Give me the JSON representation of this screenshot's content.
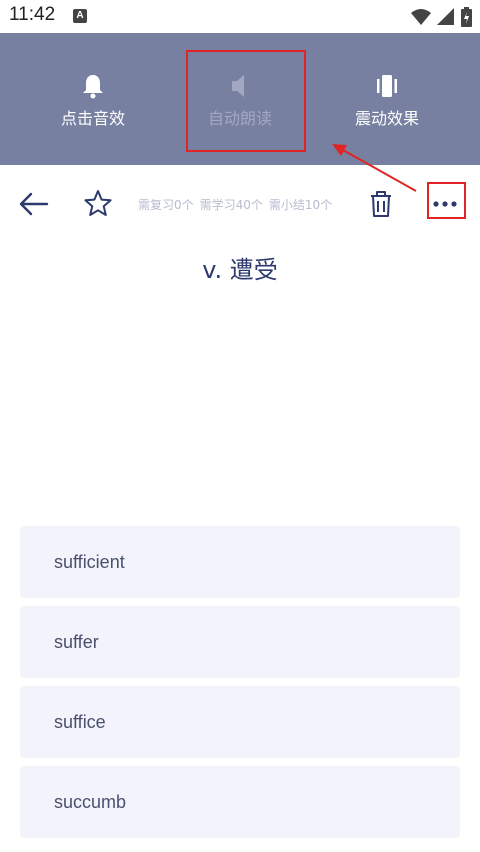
{
  "status_bar": {
    "time": "11:42",
    "notification_letter": "A"
  },
  "settings_panel": {
    "options": [
      {
        "label": "点击音效",
        "icon": "bell-icon",
        "enabled": true
      },
      {
        "label": "自动朗读",
        "icon": "speaker-icon",
        "enabled": false
      },
      {
        "label": "震动效果",
        "icon": "vibrate-icon",
        "enabled": true
      }
    ]
  },
  "toolbar": {
    "counts": {
      "review": "需复习0个",
      "learn": "需学习40个",
      "summary": "需小结10个"
    }
  },
  "question": {
    "text": "v. 遭受"
  },
  "choices": [
    "sufficient",
    "suffer",
    "suffice",
    "succumb"
  ],
  "colors": {
    "panel_bg": "#7880a2",
    "accent": "#2d3a6b",
    "choice_bg": "#f2f3fb",
    "highlight_red": "#e02424"
  }
}
